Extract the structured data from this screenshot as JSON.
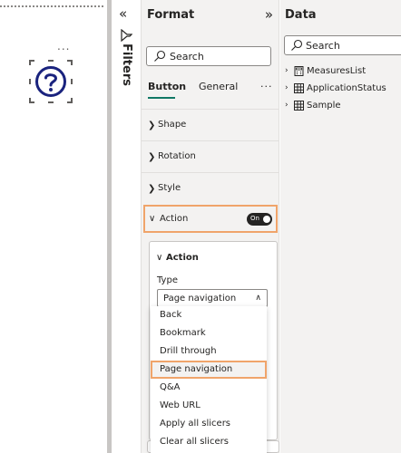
{
  "canvas": {
    "visual_more": "...",
    "visual_icon": "question-mark-circle-icon"
  },
  "filters": {
    "collapse_glyph": "«",
    "label": "Filters"
  },
  "format_pane": {
    "title": "Format",
    "expand_glyph": "»",
    "search_placeholder": "Search",
    "tabs": [
      {
        "label": "Button",
        "active": true
      },
      {
        "label": "General",
        "active": false
      }
    ],
    "more_glyph": "···",
    "sections": [
      {
        "label": "Shape"
      },
      {
        "label": "Rotation"
      },
      {
        "label": "Style"
      }
    ],
    "action_section": {
      "label": "Action",
      "toggle_label": "On",
      "toggle_on": true
    },
    "action_card": {
      "title": "Action",
      "type_label": "Type",
      "selected_value": "Page navigation"
    },
    "dropdown_options": [
      {
        "label": "Back"
      },
      {
        "label": "Bookmark"
      },
      {
        "label": "Drill through"
      },
      {
        "label": "Page navigation",
        "selected": true
      },
      {
        "label": "Q&A"
      },
      {
        "label": "Web URL"
      },
      {
        "label": "Apply all slicers"
      },
      {
        "label": "Clear all slicers"
      }
    ]
  },
  "data_pane": {
    "title": "Data",
    "search_placeholder": "Search",
    "items": [
      {
        "label": "MeasuresList",
        "icon": "calculator-table-icon"
      },
      {
        "label": "ApplicationStatus",
        "icon": "table-icon"
      },
      {
        "label": "Sample",
        "icon": "table-icon"
      }
    ]
  },
  "colors": {
    "accent_highlight": "#f0a46a",
    "tab_underline": "#117865",
    "question_icon": "#1a237e"
  }
}
